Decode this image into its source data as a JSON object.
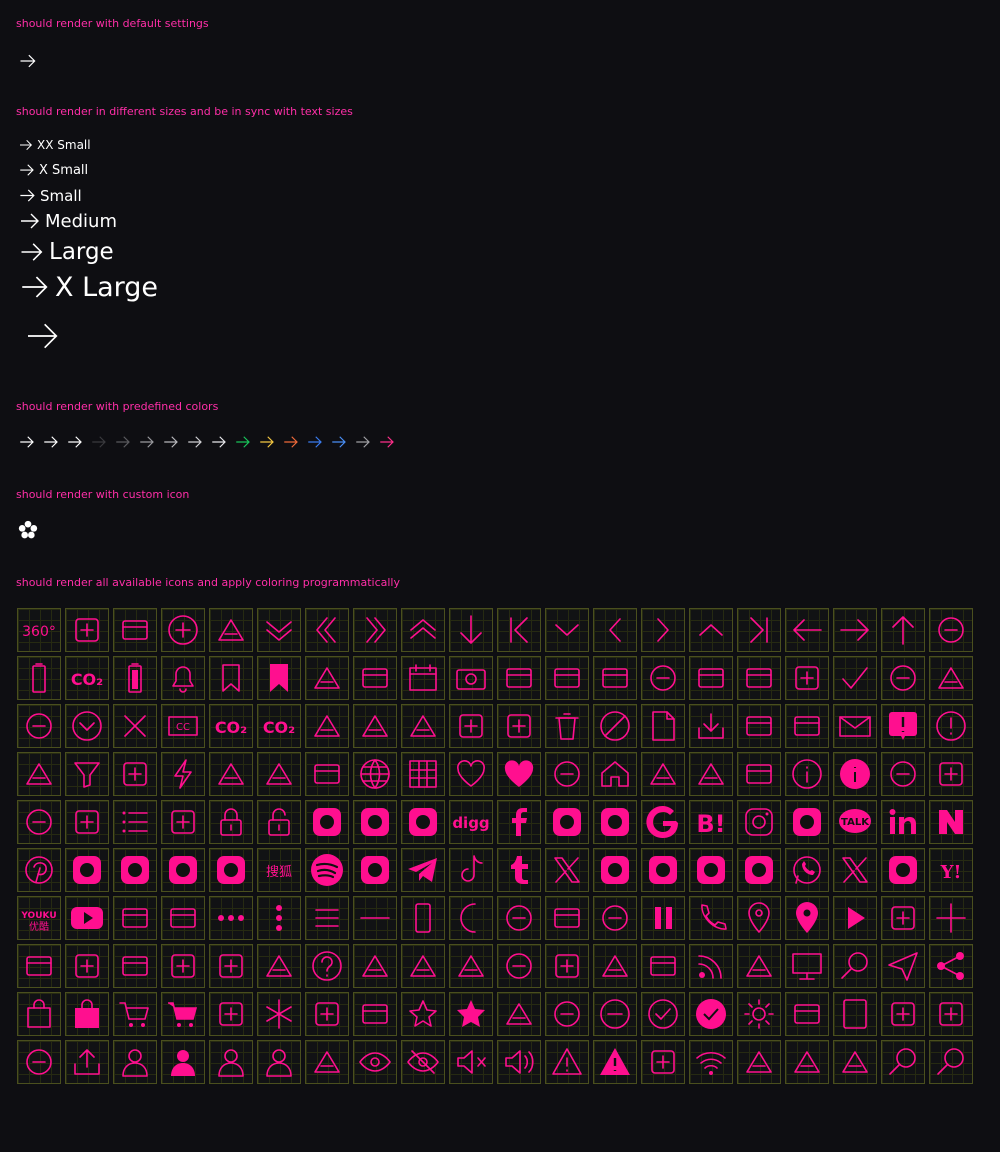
{
  "sections": {
    "default": "should render with default settings",
    "sizes": "should render in different sizes and be in sync with text sizes",
    "colors": "should render with predefined colors",
    "custom": "should render with custom icon",
    "all": "should render all available icons and apply coloring programmatically"
  },
  "sizes": [
    {
      "label": "XX Small"
    },
    {
      "label": "X Small"
    },
    {
      "label": "Small"
    },
    {
      "label": "Medium"
    },
    {
      "label": "Large"
    },
    {
      "label": "X Large"
    },
    {
      "label": ""
    }
  ],
  "colors": [
    "#ffffff",
    "#ffffff",
    "#ffffff",
    "#3a3a3e",
    "#5a5a5e",
    "#9a9a9e",
    "#b8b8bc",
    "#d0d0d4",
    "#e8e8ec",
    "#19c55a",
    "#f5c842",
    "#f06a3a",
    "#3a7cf0",
    "#4a8ff5",
    "#a0a0a4",
    "#ff2f8a"
  ],
  "accent": "#ff0f8f",
  "icons": [
    "360",
    "accessibility",
    "air-heater",
    "add",
    "adjust",
    "arrow-double-down",
    "arrow-double-left",
    "arrow-double-right",
    "arrow-double-up",
    "arrow-down",
    "arrow-first",
    "arrow-head-down",
    "arrow-head-left",
    "arrow-head-right",
    "arrow-head-up",
    "arrow-last",
    "arrow-left",
    "arrow-right",
    "arrow-up",
    "augmented-reality",
    "battery-empty",
    "battery-empty-co2",
    "battery-full",
    "bell",
    "bookmark",
    "bookmark-filled",
    "broadcast",
    "calculator",
    "calendar",
    "camera",
    "car",
    "car-battery",
    "card",
    "charging-state",
    "charging-station",
    "chart",
    "chat",
    "check",
    "city",
    "climate",
    "climate-control",
    "clock",
    "close",
    "closed-caption",
    "co2-class",
    "co2-emission",
    "compare",
    "configurate",
    "copy",
    "cubic-meter",
    "cut",
    "delete",
    "disable",
    "document",
    "download",
    "edit-end",
    "edit",
    "email",
    "error-filled",
    "exclamation",
    "external",
    "filter",
    "fingerprint",
    "flash",
    "fuel-station",
    "garage",
    "gift",
    "globe",
    "grid",
    "heart",
    "heart-filled",
    "highway",
    "home",
    "horn",
    "image",
    "increase",
    "information",
    "information-filled",
    "key",
    "leaf",
    "leather",
    "light",
    "list",
    "locate",
    "lock",
    "lock-open",
    "logo-apple-podcast",
    "logo-baidu",
    "logo-delicious",
    "logo-digg",
    "logo-facebook",
    "logo-foursquare",
    "logo-gmail",
    "logo-google",
    "logo-hatena",
    "logo-instagram",
    "logo-kaixin",
    "logo-kakaotalk",
    "logo-linkedin",
    "logo-naver",
    "logo-pinterest",
    "logo-qq",
    "logo-qq-share",
    "logo-reddit",
    "logo-skyrock",
    "logo-sohu",
    "logo-spotify",
    "logo-tecent",
    "logo-telegram",
    "logo-tiktok",
    "logo-tumblr",
    "logo-twitter",
    "logo-viber",
    "logo-vk",
    "logo-wechat",
    "logo-weibo",
    "logo-whatsapp",
    "logo-x",
    "logo-xing",
    "logo-yahoo",
    "logo-youku",
    "logo-youtube",
    "logout",
    "map",
    "menu-dots-horizontal",
    "menu-dots-vertical",
    "menu-lines",
    "minus",
    "mobile",
    "moon",
    "nav",
    "parking-brake",
    "parking-light",
    "pause",
    "phone",
    "pin",
    "pin-filled",
    "play",
    "plug",
    "plus",
    "purifier",
    "printer",
    "pivot",
    "push-pin",
    "push-pin-off",
    "qr",
    "question",
    "racing-flag",
    "refresh",
    "reset",
    "restart",
    "return",
    "route",
    "route-2",
    "rss",
    "save",
    "screen",
    "search",
    "send",
    "share",
    "shopping-bag",
    "shopping-bag-filled",
    "shopping-cart",
    "shopping-cart-filled",
    "sidelights",
    "snowflake",
    "sort",
    "stack",
    "star",
    "star-filled",
    "steering-wheel",
    "stopwatch",
    "subtract",
    "success",
    "success-filled",
    "sun",
    "switch",
    "tablet",
    "tachometer",
    "tire",
    "truck",
    "upload",
    "user",
    "user-filled",
    "user-group",
    "user-manual",
    "video",
    "view",
    "view-off",
    "volume-off",
    "volume-up",
    "warning",
    "warning-filled",
    "weight",
    "wifi",
    "work",
    "wrench",
    "wrenches",
    "zoom-in",
    "zoom-out"
  ]
}
